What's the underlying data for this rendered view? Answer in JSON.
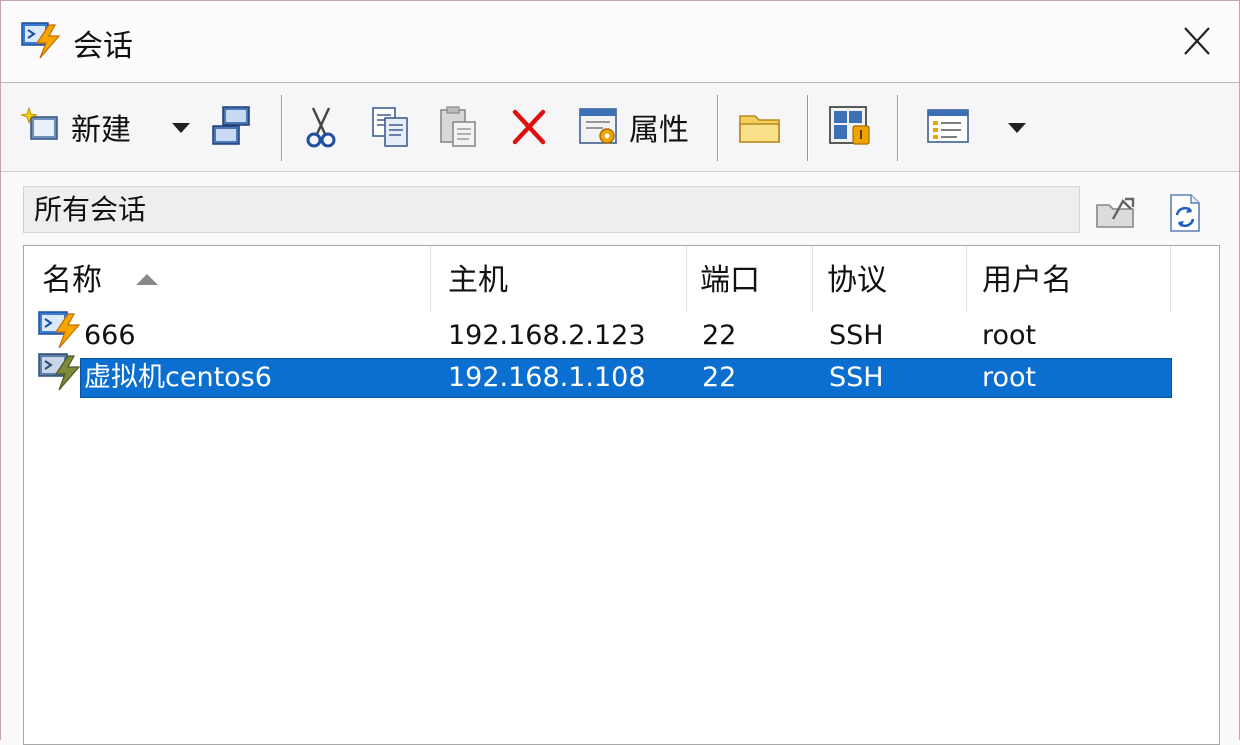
{
  "window": {
    "title": "会话"
  },
  "toolbar": {
    "new_label": "新建",
    "properties_label": "属性",
    "icons": [
      "new-session-icon",
      "dropdown-arrow-icon",
      "connect-icon",
      "cut-icon",
      "copy-icon",
      "paste-icon",
      "delete-icon",
      "properties-icon",
      "folder-icon",
      "connect-in-tab-icon",
      "view-icon",
      "dropdown-arrow-icon"
    ]
  },
  "filter": {
    "value": "所有会话"
  },
  "list": {
    "columns": [
      "名称",
      "主机",
      "端口",
      "协议",
      "用户名"
    ],
    "sorted_column": "名称",
    "rows": [
      {
        "name": "666",
        "host": "192.168.2.123",
        "port": "22",
        "protocol": "SSH",
        "user": "root",
        "selected": false
      },
      {
        "name": "虚拟机centos6",
        "host": "192.168.1.108",
        "port": "22",
        "protocol": "SSH",
        "user": "root",
        "selected": true
      }
    ]
  },
  "colors": {
    "selection": "#0a6fd0",
    "accent_bolt": "#f5a300"
  }
}
